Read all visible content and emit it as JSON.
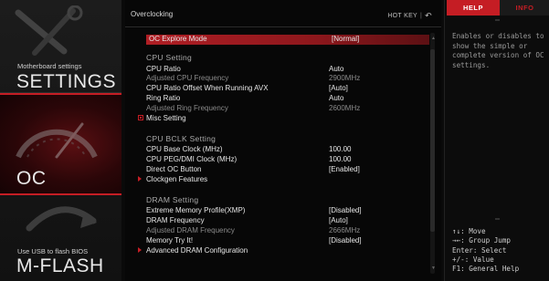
{
  "nav": {
    "settings": {
      "caption": "Motherboard settings",
      "label": "SETTINGS"
    },
    "oc": {
      "label": "OC"
    },
    "mflash": {
      "caption": "Use USB to flash BIOS",
      "label": "M-FLASH"
    }
  },
  "main": {
    "title": "Overclocking",
    "hotkey_label": "HOT KEY",
    "hotkey_sep": "|",
    "undo_icon": "undo-arrow-icon"
  },
  "rows": {
    "oc_explore": {
      "label": "OC Explore Mode",
      "value": "[Normal]"
    },
    "cpu_group": "CPU Setting",
    "cpu_ratio": {
      "label": "CPU Ratio",
      "value": "Auto"
    },
    "adj_cpu_freq": {
      "label": "Adjusted CPU Frequency",
      "value": "2900MHz"
    },
    "cpu_ratio_avx": {
      "label": "CPU Ratio Offset When Running AVX",
      "value": "[Auto]"
    },
    "ring_ratio": {
      "label": "Ring Ratio",
      "value": "Auto"
    },
    "adj_ring_freq": {
      "label": "Adjusted Ring Frequency",
      "value": "2600MHz"
    },
    "misc_setting": {
      "label": "Misc Setting"
    },
    "bclk_group": "CPU BCLK Setting",
    "cpu_base_clock": {
      "label": "CPU Base Clock (MHz)",
      "value": "100.00"
    },
    "cpu_peg_dmi": {
      "label": "CPU PEG/DMI Clock (MHz)",
      "value": "100.00"
    },
    "direct_oc": {
      "label": "Direct OC Button",
      "value": "[Enabled]"
    },
    "clockgen": {
      "label": "Clockgen Features"
    },
    "dram_group": "DRAM Setting",
    "xmp": {
      "label": "Extreme Memory Profile(XMP)",
      "value": "[Disabled]"
    },
    "dram_freq": {
      "label": "DRAM Frequency",
      "value": "[Auto]"
    },
    "adj_dram_freq": {
      "label": "Adjusted DRAM Frequency",
      "value": "2666MHz"
    },
    "memory_try": {
      "label": "Memory Try It!",
      "value": "[Disabled]"
    },
    "adv_dram": {
      "label": "Advanced DRAM Configuration"
    }
  },
  "help": {
    "tab_help": "HELP",
    "tab_info": "INFO",
    "text": "Enables or disables to show the simple or complete version of OC settings.",
    "keys": [
      "↑↓: Move",
      "→←: Group Jump",
      "Enter: Select",
      "+/-: Value",
      "F1: General Help"
    ]
  },
  "colors": {
    "accent": "#c51d24",
    "dim_text": "#8a8a8a",
    "background": "#070707"
  }
}
